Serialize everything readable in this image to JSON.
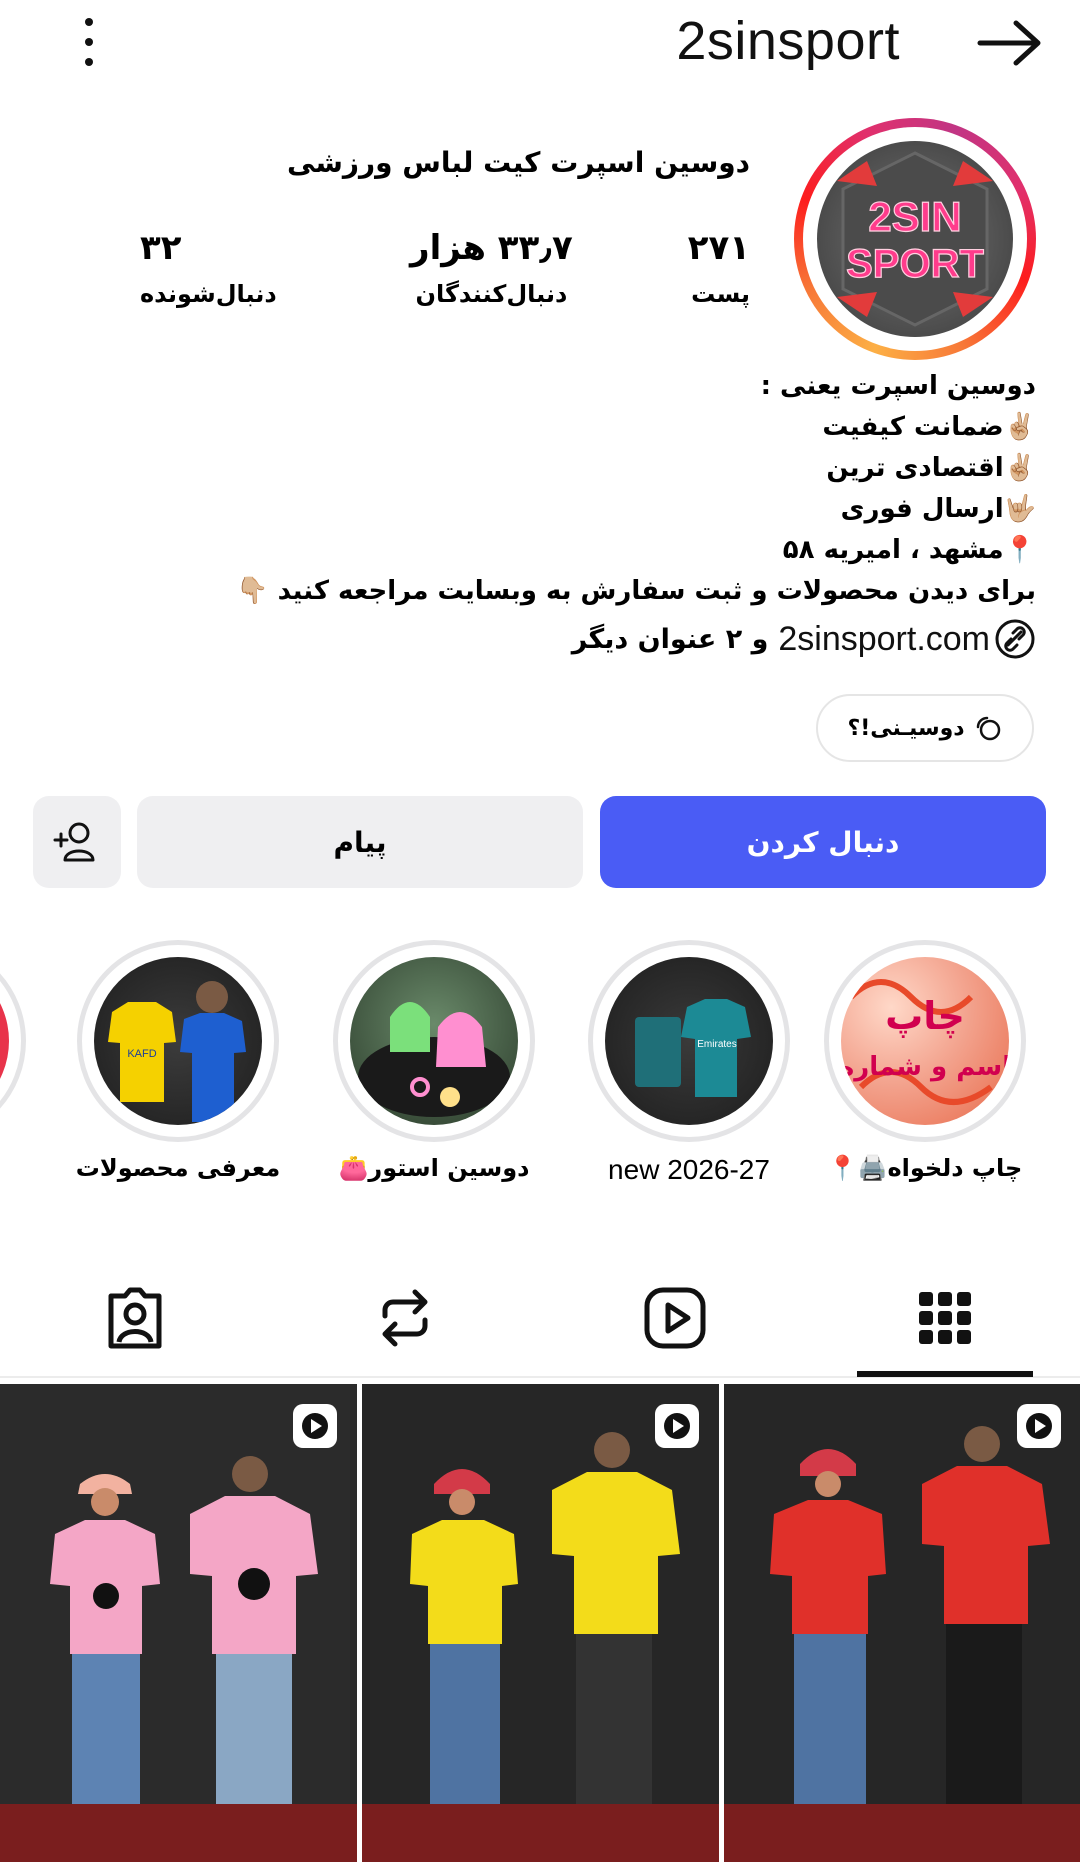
{
  "header": {
    "username": "2sinsport"
  },
  "profile": {
    "display_name": "دوسین اسپرت کیت لباس ورزشی",
    "stats": {
      "posts_value": "۲۷۱",
      "posts_label": "پست",
      "followers_value": "۳۳٫۷ هزار",
      "followers_label": "دنبال‌کنندگان",
      "following_value": "۳۲",
      "following_label": "دنبال‌شونده"
    },
    "avatar_text": [
      "2SIN",
      "SPORT"
    ],
    "bio": [
      "دوسین اسپرت یعنی :",
      "✌🏼ضمانت کیفیت",
      "✌🏼اقتصادی ترین",
      "🤟🏼ارسال فوری",
      "📍مشهد ، امیریه ۵۸",
      "برای دیدن محصولات و ثبت سفارش به وبسایت مراجعه کنید 👇🏼"
    ],
    "link": "2sinsport.com",
    "link_more": "و ۲ عنوان دیگر",
    "thread_chip": "دوسیـنی!؟"
  },
  "actions": {
    "follow": "دنبال کردن",
    "message": "پیام"
  },
  "highlights": [
    {
      "label": "چاپ دلخواه🖨️📍",
      "image_text": [
        "چاپ",
        "اسم و شماره"
      ]
    },
    {
      "label": "new 2026-27"
    },
    {
      "label": "دوسین استور👛"
    },
    {
      "label": "معرفی محصولات",
      "image_text": "KAFD"
    }
  ],
  "tabs": [
    "posts-grid",
    "reels",
    "reposts",
    "tagged"
  ],
  "colors": {
    "follow_button": "#4a5cf5",
    "secondary_button": "#efeff1",
    "accent_pink": "#ff2a6d"
  }
}
